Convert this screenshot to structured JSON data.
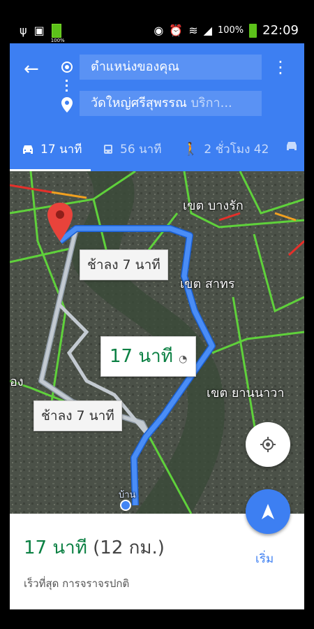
{
  "status_bar": {
    "battery_small_label": "100%",
    "battery_percent": "100%",
    "time": "22:09"
  },
  "header": {
    "origin": "ตำแหน่งของคุณ",
    "destination_main": "วัดใหญ่ศรีสุพรรณ",
    "destination_suffix": " บริกา..."
  },
  "modes": [
    {
      "icon": "car-icon",
      "label": "17 นาที",
      "active": true
    },
    {
      "icon": "bus-icon",
      "label": "56 นาที",
      "active": false
    },
    {
      "icon": "walk-icon",
      "label": "2 ชั่วโมง 42",
      "active": false
    },
    {
      "icon": "car-icon",
      "label": "",
      "active": false
    }
  ],
  "map": {
    "labels": {
      "bang_rak": "เขต บางรัก",
      "sathon": "เขต สาทร",
      "yan_nawa": "เขต ยานนาวา",
      "left_edge": "อง",
      "home": "บ้าน"
    },
    "alt_route_1": "ช้าลง 7 นาที",
    "alt_route_2": "ช้าลง 7 นาที",
    "main_route_time": "17 นาที",
    "main_route_meta": "◔"
  },
  "bottom": {
    "eta_time": "17 นาที",
    "eta_distance": " (12 กม.)",
    "subtitle": "เร็วที่สุด การจราจรปกติ",
    "start_label": "เริ่ม"
  },
  "colors": {
    "header_blue": "#3d7ff2",
    "route_blue": "#4285f4",
    "eta_green": "#0b8043"
  }
}
